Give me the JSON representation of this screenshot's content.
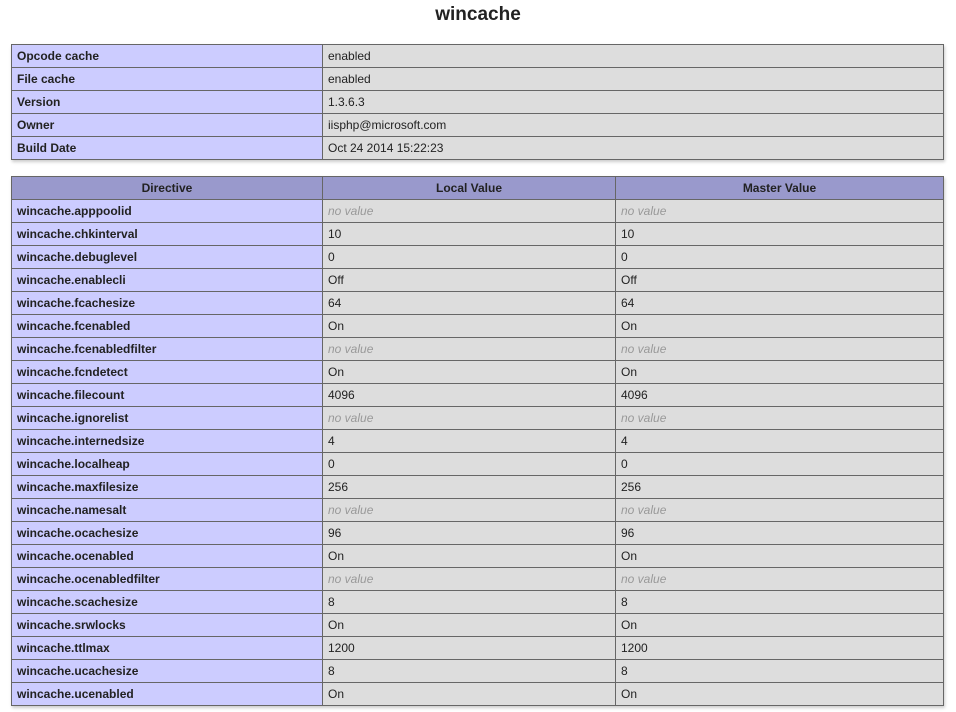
{
  "title": "wincache",
  "info": [
    {
      "label": "Opcode cache",
      "value": "enabled"
    },
    {
      "label": "File cache",
      "value": "enabled"
    },
    {
      "label": "Version",
      "value": "1.3.6.3"
    },
    {
      "label": "Owner",
      "value": "iisphp@microsoft.com"
    },
    {
      "label": "Build Date",
      "value": "Oct 24 2014 15:22:23"
    }
  ],
  "directives": {
    "headers": [
      "Directive",
      "Local Value",
      "Master Value"
    ],
    "no_value_text": "no value",
    "rows": [
      {
        "name": "wincache.apppoolid",
        "local": null,
        "master": null
      },
      {
        "name": "wincache.chkinterval",
        "local": "10",
        "master": "10"
      },
      {
        "name": "wincache.debuglevel",
        "local": "0",
        "master": "0"
      },
      {
        "name": "wincache.enablecli",
        "local": "Off",
        "master": "Off"
      },
      {
        "name": "wincache.fcachesize",
        "local": "64",
        "master": "64"
      },
      {
        "name": "wincache.fcenabled",
        "local": "On",
        "master": "On"
      },
      {
        "name": "wincache.fcenabledfilter",
        "local": null,
        "master": null
      },
      {
        "name": "wincache.fcndetect",
        "local": "On",
        "master": "On"
      },
      {
        "name": "wincache.filecount",
        "local": "4096",
        "master": "4096"
      },
      {
        "name": "wincache.ignorelist",
        "local": null,
        "master": null
      },
      {
        "name": "wincache.internedsize",
        "local": "4",
        "master": "4"
      },
      {
        "name": "wincache.localheap",
        "local": "0",
        "master": "0"
      },
      {
        "name": "wincache.maxfilesize",
        "local": "256",
        "master": "256"
      },
      {
        "name": "wincache.namesalt",
        "local": null,
        "master": null
      },
      {
        "name": "wincache.ocachesize",
        "local": "96",
        "master": "96"
      },
      {
        "name": "wincache.ocenabled",
        "local": "On",
        "master": "On"
      },
      {
        "name": "wincache.ocenabledfilter",
        "local": null,
        "master": null
      },
      {
        "name": "wincache.scachesize",
        "local": "8",
        "master": "8"
      },
      {
        "name": "wincache.srwlocks",
        "local": "On",
        "master": "On"
      },
      {
        "name": "wincache.ttlmax",
        "local": "1200",
        "master": "1200"
      },
      {
        "name": "wincache.ucachesize",
        "local": "8",
        "master": "8"
      },
      {
        "name": "wincache.ucenabled",
        "local": "On",
        "master": "On"
      }
    ]
  },
  "colors": {
    "label_cell": "#ccccff",
    "value_cell": "#dddddd",
    "header_cell": "#9999cc",
    "no_value_text": "#999999"
  }
}
